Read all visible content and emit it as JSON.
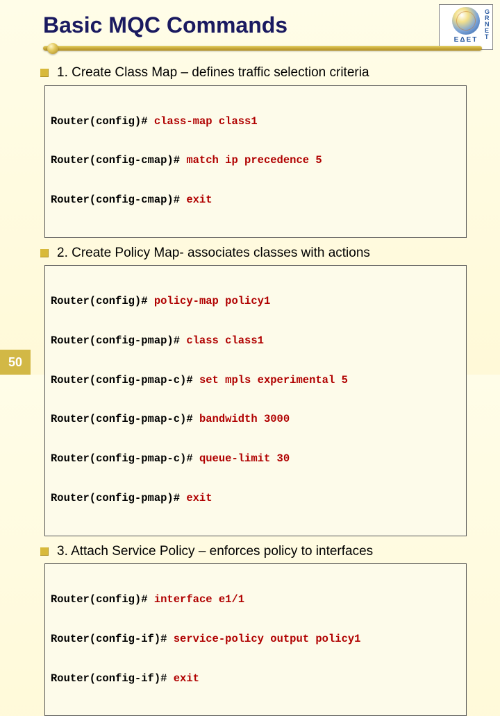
{
  "title": "Basic MQC Commands",
  "logo": {
    "right": "G\nR\nN\nE\nT",
    "bottom": "ΕΔΕΤ"
  },
  "page_number": "50",
  "sections": [
    {
      "heading": "1. Create Class Map – defines traffic selection criteria",
      "code": [
        {
          "prompt": "Router(config)#",
          "cmd": " class-map class1"
        },
        {
          "prompt": "Router(config-cmap)#",
          "cmd": " match ip precedence 5"
        },
        {
          "prompt": "Router(config-cmap)#",
          "cmd": " exit"
        }
      ]
    },
    {
      "heading": "2. Create Policy Map- associates classes with actions",
      "code": [
        {
          "prompt": "Router(config)#",
          "cmd": " policy-map policy1"
        },
        {
          "prompt": "Router(config-pmap)#",
          "cmd": " class class1"
        },
        {
          "prompt": "Router(config-pmap-c)#",
          "cmd": " set mpls experimental 5"
        },
        {
          "prompt": "Router(config-pmap-c)#",
          "cmd": " bandwidth 3000"
        },
        {
          "prompt": "Router(config-pmap-c)#",
          "cmd": " queue-limit 30"
        },
        {
          "prompt": "Router(config-pmap)#",
          "cmd": " exit"
        }
      ]
    },
    {
      "heading": "3. Attach Service Policy – enforces policy to interfaces",
      "code": [
        {
          "prompt": "Router(config)#",
          "cmd": " interface e1/1"
        },
        {
          "prompt": "Router(config-if)#",
          "cmd": " service-policy output policy1"
        },
        {
          "prompt": "Router(config-if)#",
          "cmd": " exit"
        }
      ]
    }
  ]
}
